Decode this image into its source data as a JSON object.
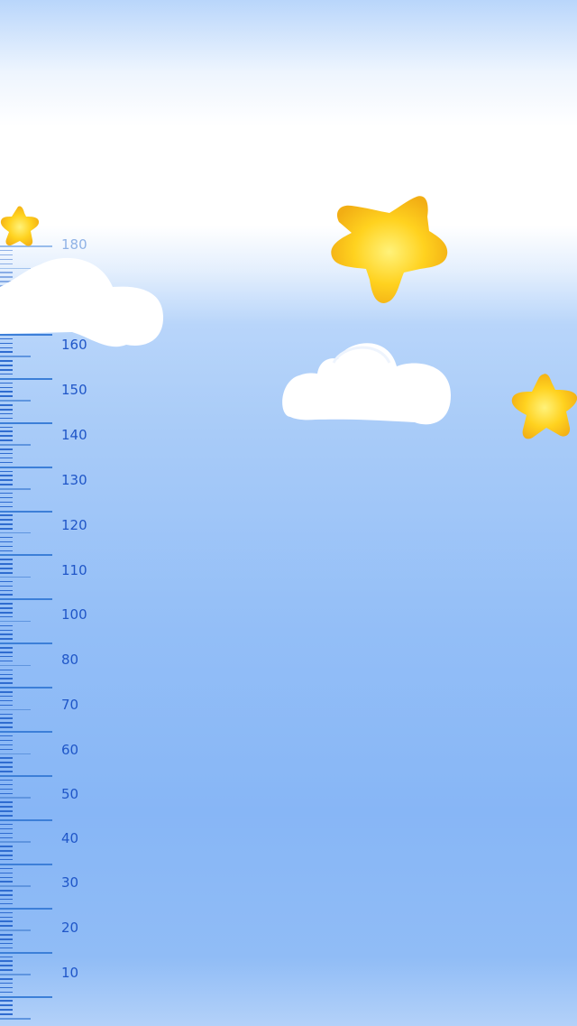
{
  "ruler": {
    "labels": [
      "180",
      "160",
      "150",
      "140",
      "130",
      "120",
      "110",
      "100",
      "80",
      "70",
      "60",
      "50",
      "40",
      "30",
      "20",
      "10"
    ]
  },
  "decorations": {
    "star_icon": "star-icon",
    "cloud_icon": "cloud-icon",
    "star_color": "#ffd21f",
    "cloud_color": "#ffffff",
    "sky_top": "#b9d6fb",
    "sky_bottom": "#87b6f6",
    "ruler_color": "#1f56c8"
  }
}
